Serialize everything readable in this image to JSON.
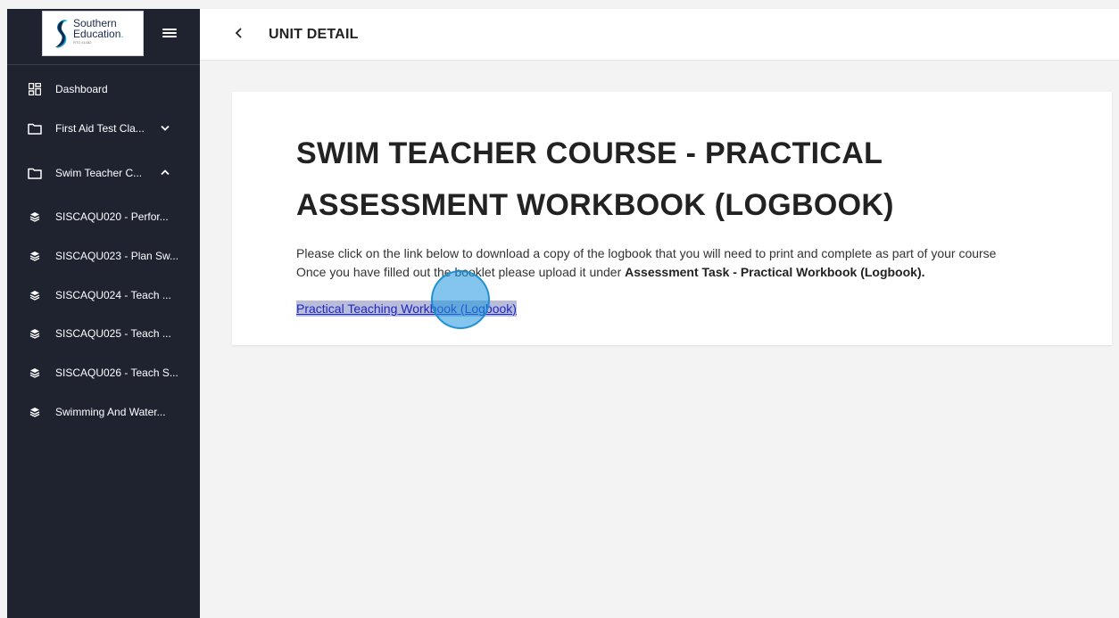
{
  "logo": {
    "line1": "Southern",
    "line2": "Education",
    "tagline": "RTO 41482"
  },
  "sidebar": {
    "items": [
      {
        "label": "Dashboard",
        "icon": "dashboard-icon"
      },
      {
        "label": "First Aid Test Cla...",
        "icon": "folder-icon",
        "chevron": "chevron-down-icon"
      },
      {
        "label": "Swim Teacher C...",
        "icon": "folder-icon",
        "chevron": "chevron-up-icon"
      },
      {
        "label": "SISCAQU020 - Perfor...",
        "icon": "layers-icon"
      },
      {
        "label": "SISCAQU023 - Plan Sw...",
        "icon": "layers-icon"
      },
      {
        "label": "SISCAQU024 - Teach ...",
        "icon": "layers-icon"
      },
      {
        "label": "SISCAQU025 - Teach ...",
        "icon": "layers-icon"
      },
      {
        "label": "SISCAQU026 - Teach S...",
        "icon": "layers-icon"
      },
      {
        "label": "Swimming And Water...",
        "icon": "layers-icon"
      }
    ]
  },
  "header": {
    "back_icon": "chevron-left-icon",
    "title": "UNIT DETAIL"
  },
  "content": {
    "heading": "SWIM TEACHER COURSE - PRACTICAL ASSESSMENT WORKBOOK (LOGBOOK)",
    "para_line1": "Please click on the link below to download a copy of the logbook that you will need to print and complete as part of your course",
    "para_line2_prefix": "Once you have filled out the booklet please upload it under ",
    "para_line2_bold": "Assessment Task - Practical Workbook (Logbook).",
    "link_text": "Practical Teaching Workbook (Logbook)"
  },
  "colors": {
    "sidebar_bg": "#1f2330",
    "link": "#1e26c8",
    "link_highlight": "#b9bdd9",
    "cursor": "#1e96dc"
  }
}
